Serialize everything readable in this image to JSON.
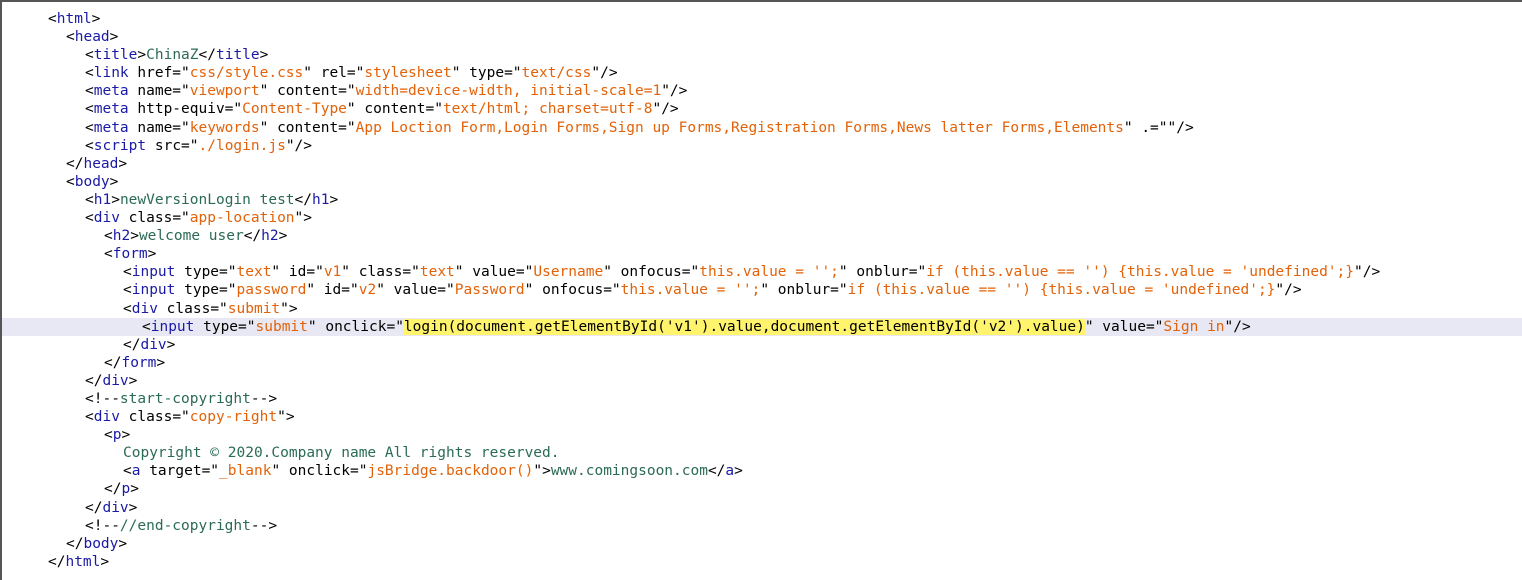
{
  "source_view": {
    "lines": [
      {
        "id": 1,
        "indent": 0,
        "parts": [
          [
            "p",
            "<"
          ],
          [
            "t",
            "html"
          ],
          [
            "p",
            ">"
          ]
        ]
      },
      {
        "id": 2,
        "indent": 1,
        "parts": [
          [
            "p",
            "<"
          ],
          [
            "t",
            "head"
          ],
          [
            "p",
            ">"
          ]
        ]
      },
      {
        "id": 3,
        "indent": 2,
        "parts": [
          [
            "p",
            "<"
          ],
          [
            "t",
            "title"
          ],
          [
            "p",
            ">"
          ],
          [
            "x",
            "ChinaZ"
          ],
          [
            "p",
            "</"
          ],
          [
            "t",
            "title"
          ],
          [
            "p",
            ">"
          ]
        ]
      },
      {
        "id": 4,
        "indent": 2,
        "parts": [
          [
            "p",
            "<"
          ],
          [
            "t",
            "link"
          ],
          [
            "p",
            " href=\""
          ],
          [
            "s",
            "css/style.css"
          ],
          [
            "p",
            "\" rel=\""
          ],
          [
            "s",
            "stylesheet"
          ],
          [
            "p",
            "\" type=\""
          ],
          [
            "s",
            "text/css"
          ],
          [
            "p",
            "\"/>"
          ]
        ]
      },
      {
        "id": 5,
        "indent": 2,
        "parts": [
          [
            "p",
            "<"
          ],
          [
            "t",
            "meta"
          ],
          [
            "p",
            " name=\""
          ],
          [
            "s",
            "viewport"
          ],
          [
            "p",
            "\" content=\""
          ],
          [
            "s",
            "width=device-width, initial-scale=1"
          ],
          [
            "p",
            "\"/>"
          ]
        ]
      },
      {
        "id": 6,
        "indent": 2,
        "parts": [
          [
            "p",
            "<"
          ],
          [
            "t",
            "meta"
          ],
          [
            "p",
            " http-equiv=\""
          ],
          [
            "s",
            "Content-Type"
          ],
          [
            "p",
            "\" content=\""
          ],
          [
            "s",
            "text/html; charset=utf-8"
          ],
          [
            "p",
            "\"/>"
          ]
        ]
      },
      {
        "id": 7,
        "indent": 2,
        "parts": [
          [
            "p",
            "<"
          ],
          [
            "t",
            "meta"
          ],
          [
            "p",
            " name=\""
          ],
          [
            "s",
            "keywords"
          ],
          [
            "p",
            "\" content=\""
          ],
          [
            "s",
            "App Loction Form,Login Forms,Sign up Forms,Registration Forms,News latter Forms,Elements"
          ],
          [
            "p",
            "\" .=\"\"/>"
          ]
        ]
      },
      {
        "id": 8,
        "indent": 2,
        "parts": [
          [
            "p",
            "<"
          ],
          [
            "t",
            "script"
          ],
          [
            "p",
            " src=\""
          ],
          [
            "s",
            "./login.js"
          ],
          [
            "p",
            "\"/>"
          ]
        ]
      },
      {
        "id": 9,
        "indent": 1,
        "parts": [
          [
            "p",
            "</"
          ],
          [
            "t",
            "head"
          ],
          [
            "p",
            ">"
          ]
        ]
      },
      {
        "id": 10,
        "indent": 1,
        "parts": [
          [
            "p",
            "<"
          ],
          [
            "t",
            "body"
          ],
          [
            "p",
            ">"
          ]
        ]
      },
      {
        "id": 11,
        "indent": 2,
        "parts": [
          [
            "p",
            "<"
          ],
          [
            "t",
            "h1"
          ],
          [
            "p",
            ">"
          ],
          [
            "x",
            "newVersionLogin test"
          ],
          [
            "p",
            "</"
          ],
          [
            "t",
            "h1"
          ],
          [
            "p",
            ">"
          ]
        ]
      },
      {
        "id": 12,
        "indent": 2,
        "parts": [
          [
            "p",
            "<"
          ],
          [
            "t",
            "div"
          ],
          [
            "p",
            " class=\""
          ],
          [
            "s",
            "app-location"
          ],
          [
            "p",
            "\">"
          ]
        ]
      },
      {
        "id": 13,
        "indent": 3,
        "parts": [
          [
            "p",
            "<"
          ],
          [
            "t",
            "h2"
          ],
          [
            "p",
            ">"
          ],
          [
            "x",
            "welcome user"
          ],
          [
            "p",
            "</"
          ],
          [
            "t",
            "h2"
          ],
          [
            "p",
            ">"
          ]
        ]
      },
      {
        "id": 14,
        "indent": 3,
        "parts": [
          [
            "p",
            "<"
          ],
          [
            "t",
            "form"
          ],
          [
            "p",
            ">"
          ]
        ]
      },
      {
        "id": 15,
        "indent": 4,
        "parts": [
          [
            "p",
            "<"
          ],
          [
            "t",
            "input"
          ],
          [
            "p",
            " type=\""
          ],
          [
            "s",
            "text"
          ],
          [
            "p",
            "\" id=\""
          ],
          [
            "s",
            "v1"
          ],
          [
            "p",
            "\" class=\""
          ],
          [
            "s",
            "text"
          ],
          [
            "p",
            "\" value=\""
          ],
          [
            "s",
            "Username"
          ],
          [
            "p",
            "\" onfocus=\""
          ],
          [
            "s",
            "this.value = '';"
          ],
          [
            "p",
            "\" onblur=\""
          ],
          [
            "s",
            "if (this.value == '') {this.value = 'undefined';}"
          ],
          [
            "p",
            "\"/>"
          ]
        ]
      },
      {
        "id": 16,
        "indent": 4,
        "parts": [
          [
            "p",
            "<"
          ],
          [
            "t",
            "input"
          ],
          [
            "p",
            " type=\""
          ],
          [
            "s",
            "password"
          ],
          [
            "p",
            "\" id=\""
          ],
          [
            "s",
            "v2"
          ],
          [
            "p",
            "\" value=\""
          ],
          [
            "s",
            "Password"
          ],
          [
            "p",
            "\" onfocus=\""
          ],
          [
            "s",
            "this.value = '';"
          ],
          [
            "p",
            "\" onblur=\""
          ],
          [
            "s",
            "if (this.value == '') {this.value = 'undefined';}"
          ],
          [
            "p",
            "\"/>"
          ]
        ]
      },
      {
        "id": 17,
        "indent": 4,
        "parts": [
          [
            "p",
            "<"
          ],
          [
            "t",
            "div"
          ],
          [
            "p",
            " class=\""
          ],
          [
            "s",
            "submit"
          ],
          [
            "p",
            "\">"
          ]
        ]
      },
      {
        "id": 18,
        "indent": 5,
        "highlight": true,
        "parts": [
          [
            "p",
            "<"
          ],
          [
            "t",
            "input"
          ],
          [
            "p",
            " type=\""
          ],
          [
            "s",
            "submit"
          ],
          [
            "p",
            "\" onclick=\""
          ],
          [
            "y",
            "login(document.getElementById('v1').value,document.getElementById('v2').value)"
          ],
          [
            "p",
            "\" value=\""
          ],
          [
            "s",
            "Sign in"
          ],
          [
            "p",
            "\"/>"
          ]
        ]
      },
      {
        "id": 19,
        "indent": 4,
        "parts": [
          [
            "p",
            "</"
          ],
          [
            "t",
            "div"
          ],
          [
            "p",
            ">"
          ]
        ]
      },
      {
        "id": 20,
        "indent": 3,
        "parts": [
          [
            "p",
            "</"
          ],
          [
            "t",
            "form"
          ],
          [
            "p",
            ">"
          ]
        ]
      },
      {
        "id": 21,
        "indent": 2,
        "parts": [
          [
            "p",
            "</"
          ],
          [
            "t",
            "div"
          ],
          [
            "p",
            ">"
          ]
        ]
      },
      {
        "id": 22,
        "indent": 2,
        "parts": [
          [
            "p",
            "<!--"
          ],
          [
            "c",
            "start-copyright"
          ],
          [
            "p",
            "-->"
          ]
        ]
      },
      {
        "id": 23,
        "indent": 2,
        "parts": [
          [
            "p",
            "<"
          ],
          [
            "t",
            "div"
          ],
          [
            "p",
            " class=\""
          ],
          [
            "s",
            "copy-right"
          ],
          [
            "p",
            "\">"
          ]
        ]
      },
      {
        "id": 24,
        "indent": 3,
        "parts": [
          [
            "p",
            "<"
          ],
          [
            "t",
            "p"
          ],
          [
            "p",
            ">"
          ]
        ]
      },
      {
        "id": 25,
        "indent": 4,
        "parts": [
          [
            "x",
            "Copyright © 2020.Company name All rights reserved."
          ]
        ]
      },
      {
        "id": 26,
        "indent": 4,
        "parts": [
          [
            "p",
            "<"
          ],
          [
            "t",
            "a"
          ],
          [
            "p",
            " target=\""
          ],
          [
            "s",
            "_blank"
          ],
          [
            "p",
            "\" onclick=\""
          ],
          [
            "s",
            "jsBridge.backdoor()"
          ],
          [
            "p",
            "\">"
          ],
          [
            "x",
            "www.comingsoon.com"
          ],
          [
            "p",
            "</"
          ],
          [
            "t",
            "a"
          ],
          [
            "p",
            ">"
          ]
        ]
      },
      {
        "id": 27,
        "indent": 3,
        "parts": [
          [
            "p",
            "</"
          ],
          [
            "t",
            "p"
          ],
          [
            "p",
            ">"
          ]
        ]
      },
      {
        "id": 28,
        "indent": 2,
        "parts": [
          [
            "p",
            "</"
          ],
          [
            "t",
            "div"
          ],
          [
            "p",
            ">"
          ]
        ]
      },
      {
        "id": 29,
        "indent": 2,
        "parts": [
          [
            "p",
            "<!--"
          ],
          [
            "c",
            "//end-copyright"
          ],
          [
            "p",
            "-->"
          ]
        ]
      },
      {
        "id": 30,
        "indent": 1,
        "parts": [
          [
            "p",
            "</"
          ],
          [
            "t",
            "body"
          ],
          [
            "p",
            ">"
          ]
        ]
      },
      {
        "id": 31,
        "indent": 0,
        "parts": [
          [
            "p",
            "</"
          ],
          [
            "t",
            "html"
          ],
          [
            "p",
            ">"
          ]
        ]
      }
    ]
  },
  "colors": {
    "tag": "#1a1aa6",
    "attr_value": "#e36209",
    "text": "#2b6b54",
    "highlight_line": "#e8e8f4",
    "highlight_match": "#fff46c"
  }
}
